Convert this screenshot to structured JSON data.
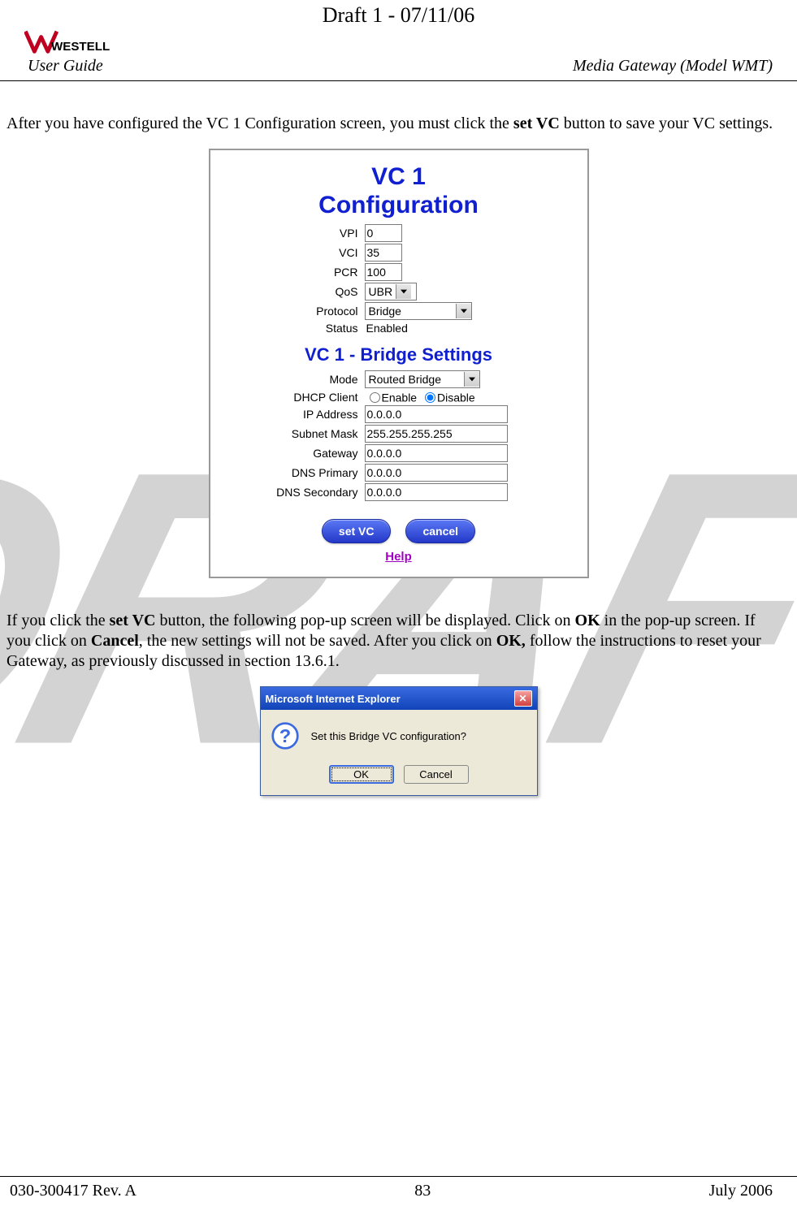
{
  "draft_header": "Draft 1 - 07/11/06",
  "header": {
    "user_guide": "User Guide",
    "model_label": "Media Gateway (Model WMT)",
    "logo_text": "WESTELL"
  },
  "watermark": "DRAFT",
  "para1_pre": "After you have configured the VC 1 Configuration screen, you must click the ",
  "para1_bold": "set VC",
  "para1_post": " button to save your VC settings.",
  "config": {
    "title_line1": "VC 1",
    "title_line2": "Configuration",
    "vpi_label": "VPI",
    "vpi_value": "0",
    "vci_label": "VCI",
    "vci_value": "35",
    "pcr_label": "PCR",
    "pcr_value": "100",
    "qos_label": "QoS",
    "qos_value": "UBR",
    "protocol_label": "Protocol",
    "protocol_value": "Bridge",
    "status_label": "Status",
    "status_value": "Enabled",
    "bridge_title": "VC 1 - Bridge Settings",
    "mode_label": "Mode",
    "mode_value": "Routed Bridge",
    "dhcp_label": "DHCP Client",
    "dhcp_enable": "Enable",
    "dhcp_disable": "Disable",
    "ip_label": "IP Address",
    "ip_value": "0.0.0.0",
    "mask_label": "Subnet Mask",
    "mask_value": "255.255.255.255",
    "gw_label": "Gateway",
    "gw_value": "0.0.0.0",
    "dns1_label": "DNS Primary",
    "dns1_value": "0.0.0.0",
    "dns2_label": "DNS Secondary",
    "dns2_value": "0.0.0.0",
    "setvc_btn": "set VC",
    "cancel_btn": "cancel",
    "help_link": "Help"
  },
  "para2": {
    "t1": "If you click the ",
    "b1": "set VC",
    "t2": " button, the following pop-up screen will be displayed. Click on ",
    "b2": "OK",
    "t3": " in the pop-up screen. If you click on ",
    "b3": "Cancel",
    "t4": ", the new settings will not be saved. After you click on ",
    "b4": "OK,",
    "t5": " follow the instructions to reset your Gateway, as previously discussed in section 13.6.1."
  },
  "popup": {
    "title": "Microsoft Internet Explorer",
    "message": "Set this Bridge VC configuration?",
    "ok_label": "OK",
    "cancel_label": "Cancel"
  },
  "footer": {
    "left": "030-300417 Rev. A",
    "center": "83",
    "right": "July 2006"
  }
}
